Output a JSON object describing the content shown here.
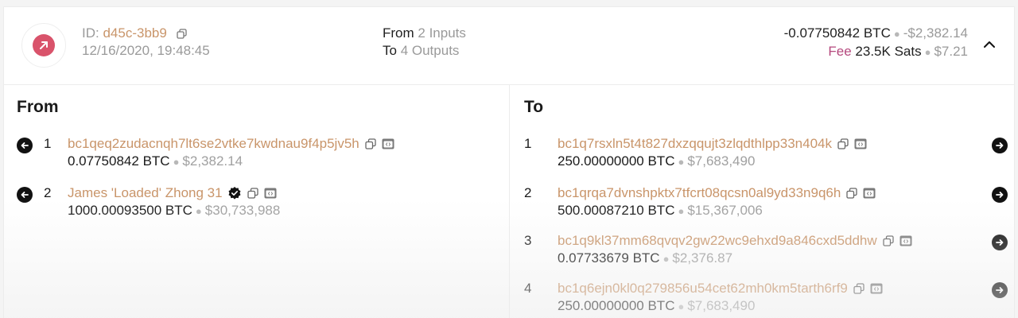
{
  "summary": {
    "id_label": "ID:",
    "id_value": "d45c-3bb9",
    "datetime": "12/16/2020, 19:48:45",
    "from_label": "From",
    "from_count": "2 Inputs",
    "to_label": "To",
    "to_count": "4 Outputs",
    "amount_btc": "-0.07750842 BTC",
    "amount_usd": "-$2,382.14",
    "fee_label": "Fee",
    "fee_sats": "23.5K Sats",
    "fee_usd": "$7.21",
    "tx_icon": "arrow-up-right-icon",
    "tx_icon_color": "#d9536b",
    "expand_icon": "chevron-up-icon"
  },
  "from": {
    "title": "From",
    "inputs": [
      {
        "index": "1",
        "address": "bc1qeq2zudacnqh7lt6se2vtke7kwdnau9f4p5jv5h",
        "btc": "0.07750842",
        "unit": "BTC",
        "usd": "$2,382.14",
        "verified": false
      },
      {
        "index": "2",
        "address": "James 'Loaded' Zhong 31",
        "btc": "1000.00093500",
        "unit": "BTC",
        "usd": "$30,733,988",
        "verified": true
      }
    ]
  },
  "to": {
    "title": "To",
    "outputs": [
      {
        "index": "1",
        "address": "bc1q7rsxln5t4t827dxzqqujt3zlqdthlpp33n404k",
        "btc": "250.00000000",
        "unit": "BTC",
        "usd": "$7,683,490"
      },
      {
        "index": "2",
        "address": "bc1qrqa7dvnshpktx7tfcrt08qcsn0al9yd33n9q6h",
        "btc": "500.00087210",
        "unit": "BTC",
        "usd": "$15,367,006"
      },
      {
        "index": "3",
        "address": "bc1q9kl37mm68qvqv2gw22wc9ehxd9a846cxd5ddhw",
        "btc": "0.07733679",
        "unit": "BTC",
        "usd": "$2,376.87"
      },
      {
        "index": "4",
        "address": "bc1q6ejn0kl0q279856u54cet62mh0km5tarth6rf9",
        "btc": "250.00000000",
        "unit": "BTC",
        "usd": "$7,683,490"
      }
    ]
  },
  "colors": {
    "accent_copper": "#c9956a",
    "fee_pink": "#b5497e",
    "muted": "#9a9a9a"
  },
  "icons": {
    "copy": "copy-icon",
    "explorer": "explorer-icon",
    "left_arrow": "arrow-left-circle-icon",
    "right_arrow": "arrow-right-circle-icon",
    "verified": "verified-badge-icon"
  }
}
